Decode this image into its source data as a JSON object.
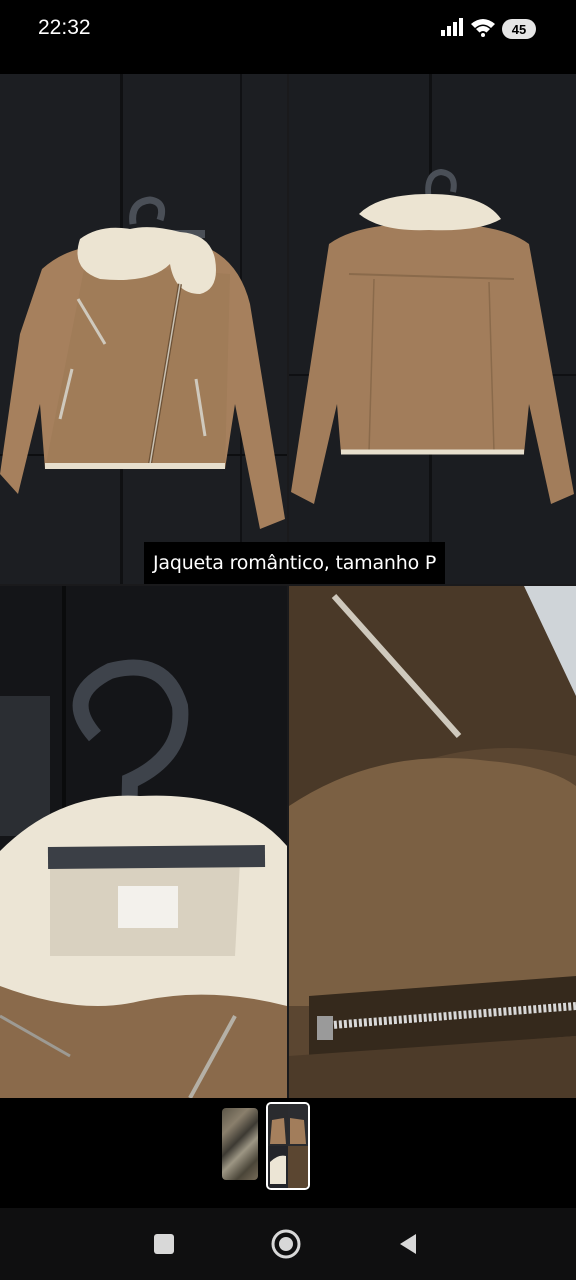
{
  "status_bar": {
    "time": "22:32",
    "battery_level": "45",
    "icons": [
      "signal-icon",
      "wifi-icon",
      "battery-icon"
    ]
  },
  "story": {
    "caption": "Jaqueta romântico, tamanho P",
    "panels": [
      "jacket-front-photo",
      "jacket-back-photo",
      "jacket-collar-label-photo",
      "jacket-zipper-closeup-photo"
    ]
  },
  "thumbnails": {
    "count": 2,
    "selected_index": 1
  },
  "nav_bar": {
    "buttons": [
      "recents-square-icon",
      "home-circle-icon",
      "back-triangle-icon"
    ]
  },
  "colors": {
    "jacket_tan": "#a07857",
    "fur_cream": "#ece4d2",
    "wall_dark": "#1b1d21",
    "hanger_gray": "#3b3f46"
  }
}
